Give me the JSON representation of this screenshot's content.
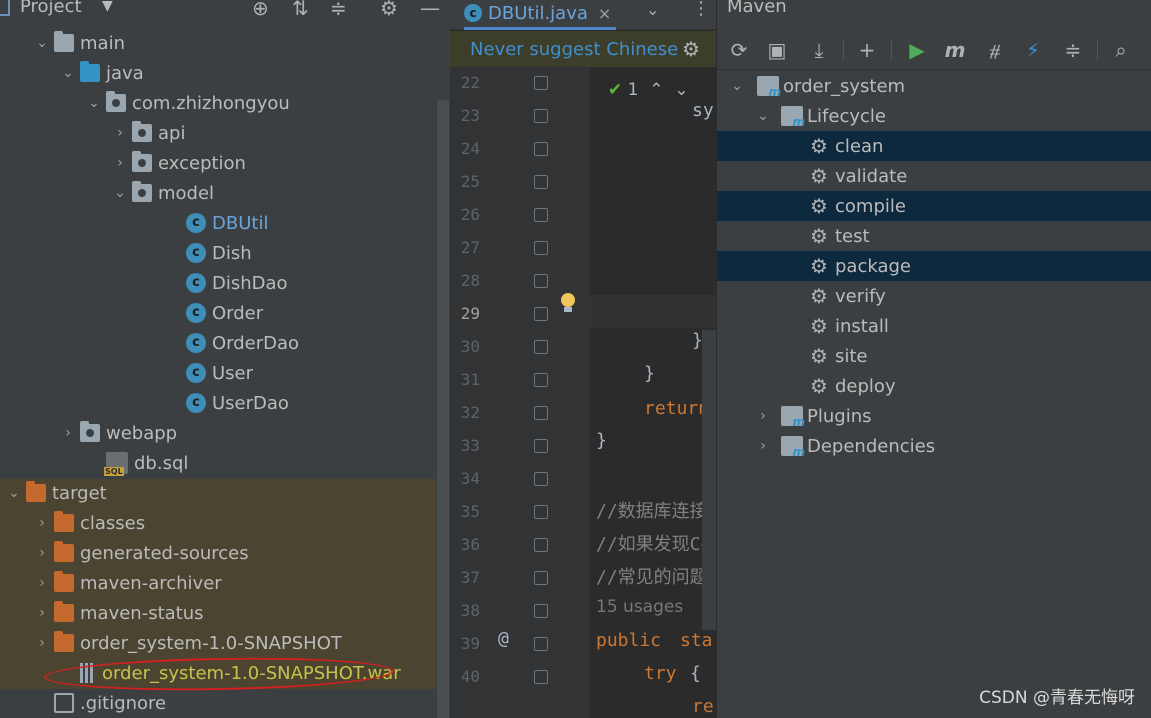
{
  "project": {
    "title": "Project",
    "tree": [
      {
        "label": "main",
        "icon": "folder-grey",
        "arrow": "⌄"
      },
      {
        "label": "java",
        "icon": "folder-blue",
        "arrow": "⌄"
      },
      {
        "label": "com.zhizhongyou",
        "icon": "package",
        "arrow": "⌄"
      },
      {
        "label": "api",
        "icon": "package",
        "arrow": "›"
      },
      {
        "label": "exception",
        "icon": "package",
        "arrow": "›"
      },
      {
        "label": "model",
        "icon": "package",
        "arrow": "⌄"
      },
      {
        "label": "DBUtil",
        "icon": "class"
      },
      {
        "label": "Dish",
        "icon": "class"
      },
      {
        "label": "DishDao",
        "icon": "class"
      },
      {
        "label": "Order",
        "icon": "class"
      },
      {
        "label": "OrderDao",
        "icon": "class"
      },
      {
        "label": "User",
        "icon": "class"
      },
      {
        "label": "UserDao",
        "icon": "class"
      },
      {
        "label": "webapp",
        "icon": "folder-web",
        "arrow": "›"
      },
      {
        "label": "db.sql",
        "icon": "sql"
      },
      {
        "label": "target",
        "icon": "folder-orange",
        "arrow": "⌄"
      },
      {
        "label": "classes",
        "icon": "folder-orange",
        "arrow": "›"
      },
      {
        "label": "generated-sources",
        "icon": "folder-orange",
        "arrow": "›"
      },
      {
        "label": "maven-archiver",
        "icon": "folder-orange",
        "arrow": "›"
      },
      {
        "label": "maven-status",
        "icon": "folder-orange",
        "arrow": "›"
      },
      {
        "label": "order_system-1.0-SNAPSHOT",
        "icon": "folder-orange",
        "arrow": "›"
      },
      {
        "label": "order_system-1.0-SNAPSHOT.war",
        "icon": "war"
      },
      {
        "label": ".gitignore",
        "icon": "git"
      }
    ]
  },
  "editor": {
    "tab_label": "DBUtil.java",
    "tab_close": "×",
    "banner": "Never suggest Chinese",
    "inspection_count": "1",
    "line_numbers": [
      "22",
      "23",
      "24",
      "25",
      "26",
      "27",
      "28",
      "29",
      "30",
      "31",
      "32",
      "33",
      "34",
      "35",
      "36",
      "37",
      "38",
      "39",
      "40"
    ],
    "current_line": "29",
    "code": {
      "sy": "sy",
      "brace_inner": "}",
      "brace_mid": "}",
      "return": "return",
      "brace_outer": "}",
      "comment1": "//数据库连接",
      "comment2": "//如果发现Co",
      "comment3": "//常见的问题",
      "usages": "15 usages",
      "at": "@",
      "public": "public",
      "sta": "sta",
      "try": "try",
      "brace_open": "{",
      "re": "re"
    }
  },
  "maven": {
    "title": "Maven",
    "project": "order_system",
    "lifecycle": "Lifecycle",
    "phases": [
      "clean",
      "validate",
      "compile",
      "test",
      "package",
      "verify",
      "install",
      "site",
      "deploy"
    ],
    "selected": [
      "clean",
      "compile",
      "package"
    ],
    "plugins": "Plugins",
    "dependencies": "Dependencies"
  },
  "watermark": "CSDN @青春无悔呀",
  "colors": {
    "selection": "#0d293e",
    "target_bg": "#4a4430",
    "war_text": "#c7c34a",
    "annotation_circle": "#d02020"
  }
}
